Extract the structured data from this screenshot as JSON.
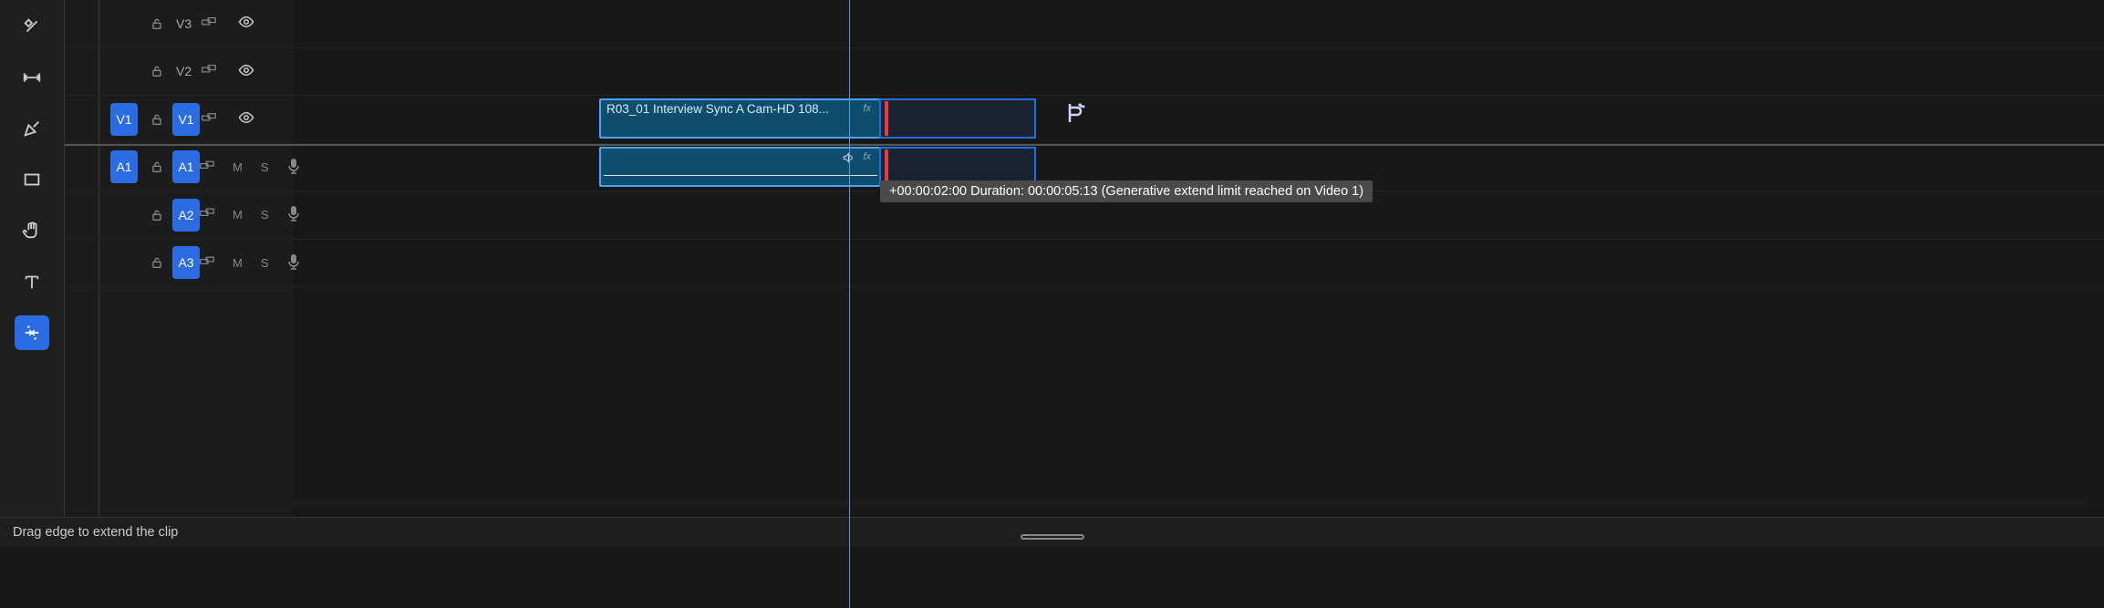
{
  "tools": [
    "razor",
    "ripple",
    "pen",
    "rectangle",
    "hand",
    "type",
    "remix"
  ],
  "activeTool": "remix",
  "tracks": {
    "video": [
      {
        "name": "V3",
        "source": false,
        "targeted": false
      },
      {
        "name": "V2",
        "source": false,
        "targeted": false
      },
      {
        "name": "V1",
        "source": true,
        "targeted": true
      }
    ],
    "audio": [
      {
        "name": "A1",
        "source": true,
        "targeted": true
      },
      {
        "name": "A2",
        "source": false,
        "targeted": true
      },
      {
        "name": "A3",
        "source": false,
        "targeted": true
      }
    ]
  },
  "clips": {
    "video_clip": {
      "label": "R03_01 Interview Sync A Cam-HD 108...",
      "fx": "fx"
    },
    "audio_clip": {
      "fx": "fx"
    }
  },
  "tooltip": "+00:00:02:00 Duration: 00:00:05:13 (Generative extend limit reached on Video 1)",
  "status_text": "Drag edge to extend the clip",
  "toggle_labels": {
    "mute": "M",
    "solo": "S"
  }
}
